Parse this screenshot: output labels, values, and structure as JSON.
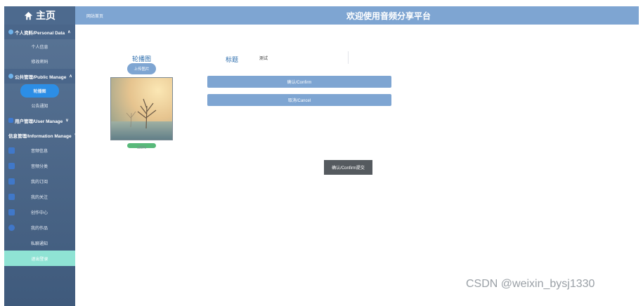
{
  "colors": {
    "sidebar": "#4d6a8e",
    "topbar": "#7ea5d2",
    "accent": "#2c8ee6",
    "label": "#2f6fae",
    "progress": "#58b97a",
    "logout": "#8fe3d4"
  },
  "sidebar": {
    "brand": "主页",
    "brand_icon": "home-icon",
    "personal": {
      "label": "个人资料/Personal Data",
      "items": [
        "个人信息",
        "修改密码"
      ]
    },
    "public": {
      "label": "公共管理/Public Manage",
      "items": [
        "轮播图",
        "公告通知"
      ]
    },
    "user_manage": "用户管理/User Manage",
    "info_manage": "信息管理/Information Manage",
    "nav": [
      "音频信息",
      "音频分类",
      "我的订阅",
      "我的关注",
      "创作中心",
      "我的作品",
      "私聊通知"
    ],
    "logout": "退出登录"
  },
  "topbar": {
    "breadcrumb": "网站首页",
    "title": "欢迎使用音频分享平台"
  },
  "form": {
    "carousel_label": "轮播图",
    "upload_label": "上传图片",
    "progress_text": "100%",
    "progress_value": 1.0,
    "title_label": "标题",
    "title_value": "测试",
    "confirm_label": "确认/Confirm",
    "cancel_label": "取消/Cancel",
    "confirm_dark_label": "确认/Confirm提交"
  },
  "watermark": "CSDN @weixin_bysj1330"
}
